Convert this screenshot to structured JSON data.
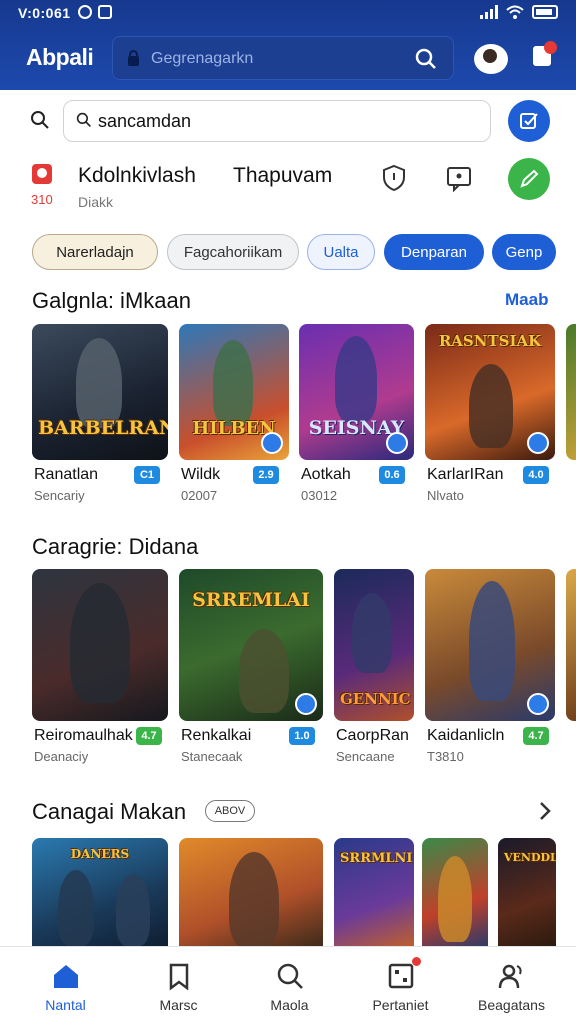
{
  "status_bar": {
    "time": "V:0:061"
  },
  "app_bar": {
    "title": "Abpali",
    "search_placeholder": "Gegrenagarkn"
  },
  "search": {
    "value": "sancamdan"
  },
  "profile": {
    "badge_count": "310",
    "name": "Kdolnkivlash",
    "subtitle": "Diakk",
    "name2": "Thapuvam"
  },
  "chips": [
    "Narerladajn",
    "Fagcahoriikam",
    "Ualta",
    "Denparan",
    "Genp"
  ],
  "colors": {
    "primary": "#1f5fd6",
    "appbar": "#1d49ad",
    "success": "#3bb54a",
    "alert": "#e53935"
  },
  "sections": [
    {
      "title": "Galgnla: iMkaan",
      "more": "Maab",
      "items": [
        {
          "name": "Ranatlan",
          "sub": "Sencariy",
          "badge": "C1",
          "art_title": "BARBELRAN"
        },
        {
          "name": "Wildk",
          "sub": "02007",
          "badge": "2.9",
          "art_title": "HILBEN"
        },
        {
          "name": "Aotkah",
          "sub": "03012",
          "badge": "0.6",
          "art_title": "SEISNAY"
        },
        {
          "name": "KarlarIRan",
          "sub": "Nlvato",
          "badge": "4.0",
          "art_title": "RASNTSIAK"
        }
      ]
    },
    {
      "title": "Caragrie: Didana",
      "items": [
        {
          "name": "Reiromaulhak",
          "sub": "Deanaciy",
          "badge": "4.7",
          "art_title": ""
        },
        {
          "name": "Renkalkai",
          "sub": "Stanecaak",
          "badge": "1.0",
          "art_title": "SRREMLAI"
        },
        {
          "name": "CaorpRan",
          "sub": "Sencaane",
          "badge": "",
          "art_title": "GENNIC"
        },
        {
          "name": "Kaidanlicln",
          "sub": "T3810",
          "badge": "4.7",
          "art_title": ""
        }
      ]
    },
    {
      "title": "Canagai Makan",
      "pill": "ABOV",
      "items": [
        {
          "art_title": "DANERS"
        },
        {
          "art_title": ""
        },
        {
          "art_title": "SRRMLNI"
        },
        {
          "art_title": ""
        },
        {
          "art_title": "VENDDLE"
        }
      ]
    }
  ],
  "bottom_nav": [
    {
      "label": "Nantal",
      "icon": "home-icon"
    },
    {
      "label": "Marsc",
      "icon": "bookmark-icon"
    },
    {
      "label": "Maola",
      "icon": "search-icon"
    },
    {
      "label": "Pertaniet",
      "icon": "grid-icon"
    },
    {
      "label": "Beagatans",
      "icon": "people-icon"
    }
  ]
}
